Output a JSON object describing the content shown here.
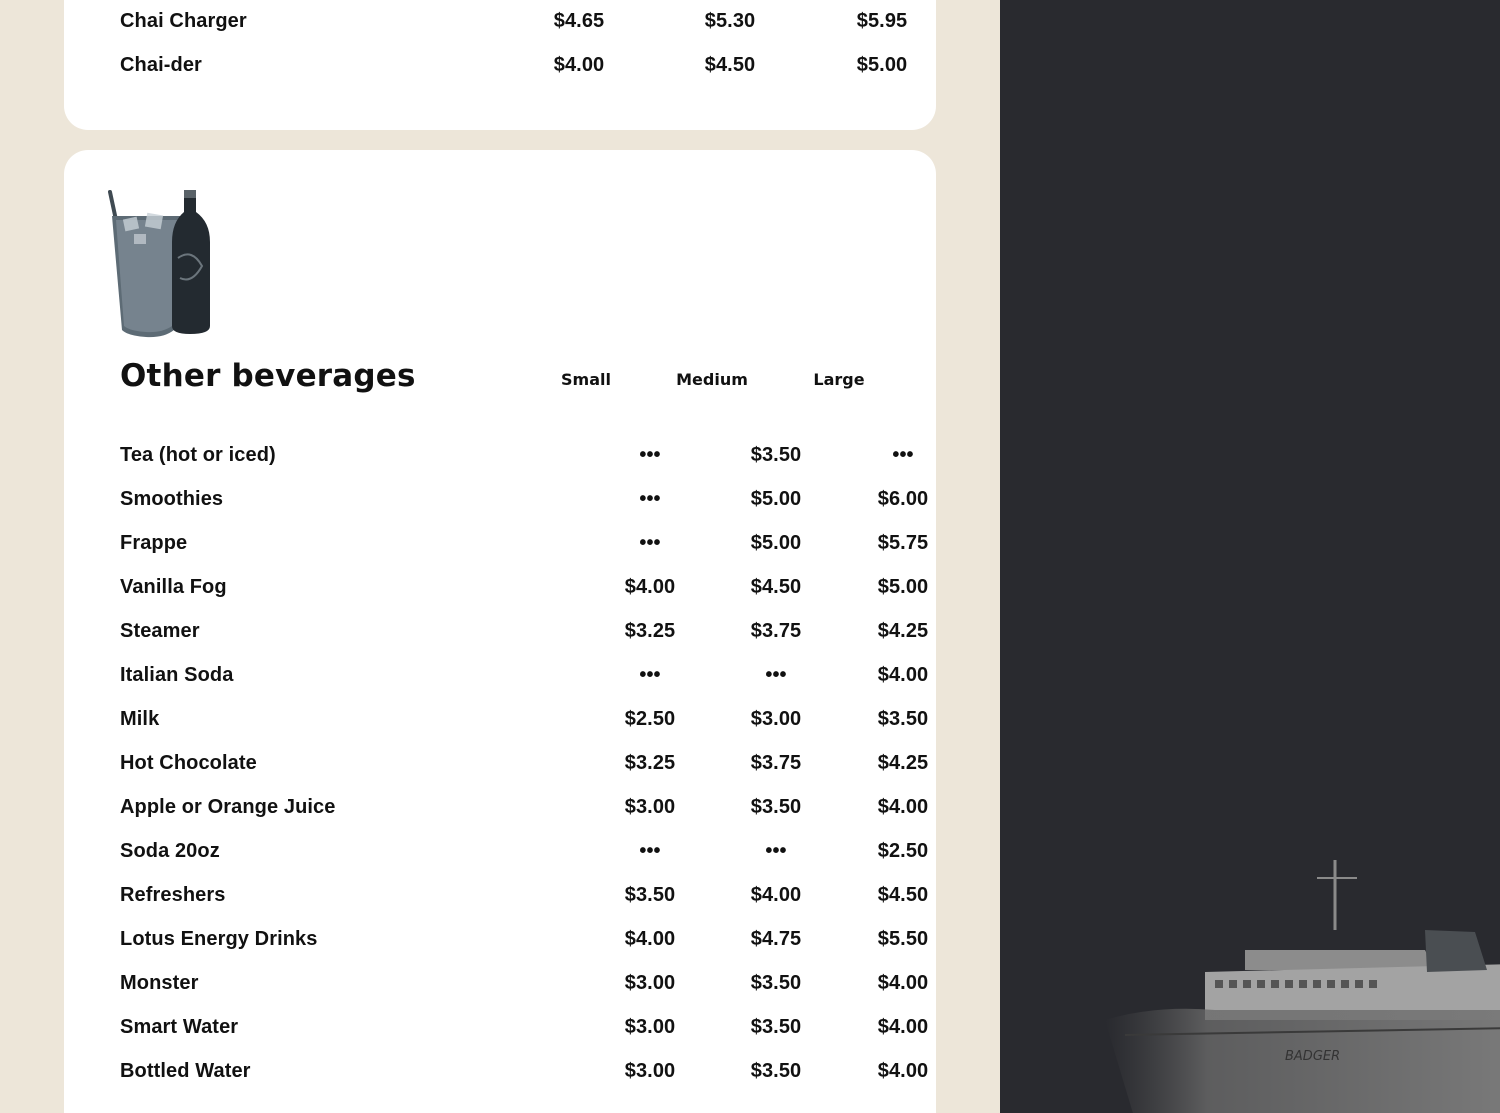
{
  "top_section": {
    "rows": [
      {
        "name": "Chai Charger",
        "prices": [
          "$4.65",
          "$5.30",
          "$5.95"
        ]
      },
      {
        "name": "Chai-der",
        "prices": [
          "$4.00",
          "$4.50",
          "$5.00"
        ]
      }
    ]
  },
  "other_beverages": {
    "title": "Other beverages",
    "columns": [
      "Small",
      "Medium",
      "Large"
    ],
    "rows": [
      {
        "name": "Tea (hot or iced)",
        "prices": [
          "•••",
          "$3.50",
          "•••"
        ]
      },
      {
        "name": "Smoothies",
        "prices": [
          "•••",
          "$5.00",
          "$6.00"
        ]
      },
      {
        "name": "Frappe",
        "prices": [
          "•••",
          "$5.00",
          "$5.75"
        ]
      },
      {
        "name": "Vanilla Fog",
        "prices": [
          "$4.00",
          "$4.50",
          "$5.00"
        ]
      },
      {
        "name": "Steamer",
        "prices": [
          "$3.25",
          "$3.75",
          "$4.25"
        ]
      },
      {
        "name": "Italian Soda",
        "prices": [
          "•••",
          "•••",
          "$4.00"
        ]
      },
      {
        "name": "Milk",
        "prices": [
          "$2.50",
          "$3.00",
          "$3.50"
        ]
      },
      {
        "name": "Hot Chocolate",
        "prices": [
          "$3.25",
          "$3.75",
          "$4.25"
        ]
      },
      {
        "name": "Apple or Orange Juice",
        "prices": [
          "$3.00",
          "$3.50",
          "$4.00"
        ]
      },
      {
        "name": "Soda 20oz",
        "prices": [
          "•••",
          "•••",
          "$2.50"
        ]
      },
      {
        "name": "Refreshers",
        "prices": [
          "$3.50",
          "$4.00",
          "$4.50"
        ]
      },
      {
        "name": "Lotus Energy Drinks",
        "prices": [
          "$4.00",
          "$4.75",
          "$5.50"
        ]
      },
      {
        "name": "Monster",
        "prices": [
          "$3.00",
          "$3.50",
          "$4.00"
        ]
      },
      {
        "name": "Smart Water",
        "prices": [
          "$3.00",
          "$3.50",
          "$4.00"
        ]
      },
      {
        "name": "Bottled Water",
        "prices": [
          "$3.00",
          "$3.50",
          "$4.00"
        ]
      }
    ]
  },
  "decor": {
    "beverage_image": "glass-and-bottle-icon",
    "ship_name": "BADGER"
  },
  "colors": {
    "page_bg": "#ede6d9",
    "card_bg": "#ffffff",
    "right_panel_bg": "#292a2f",
    "text": "#111111"
  }
}
